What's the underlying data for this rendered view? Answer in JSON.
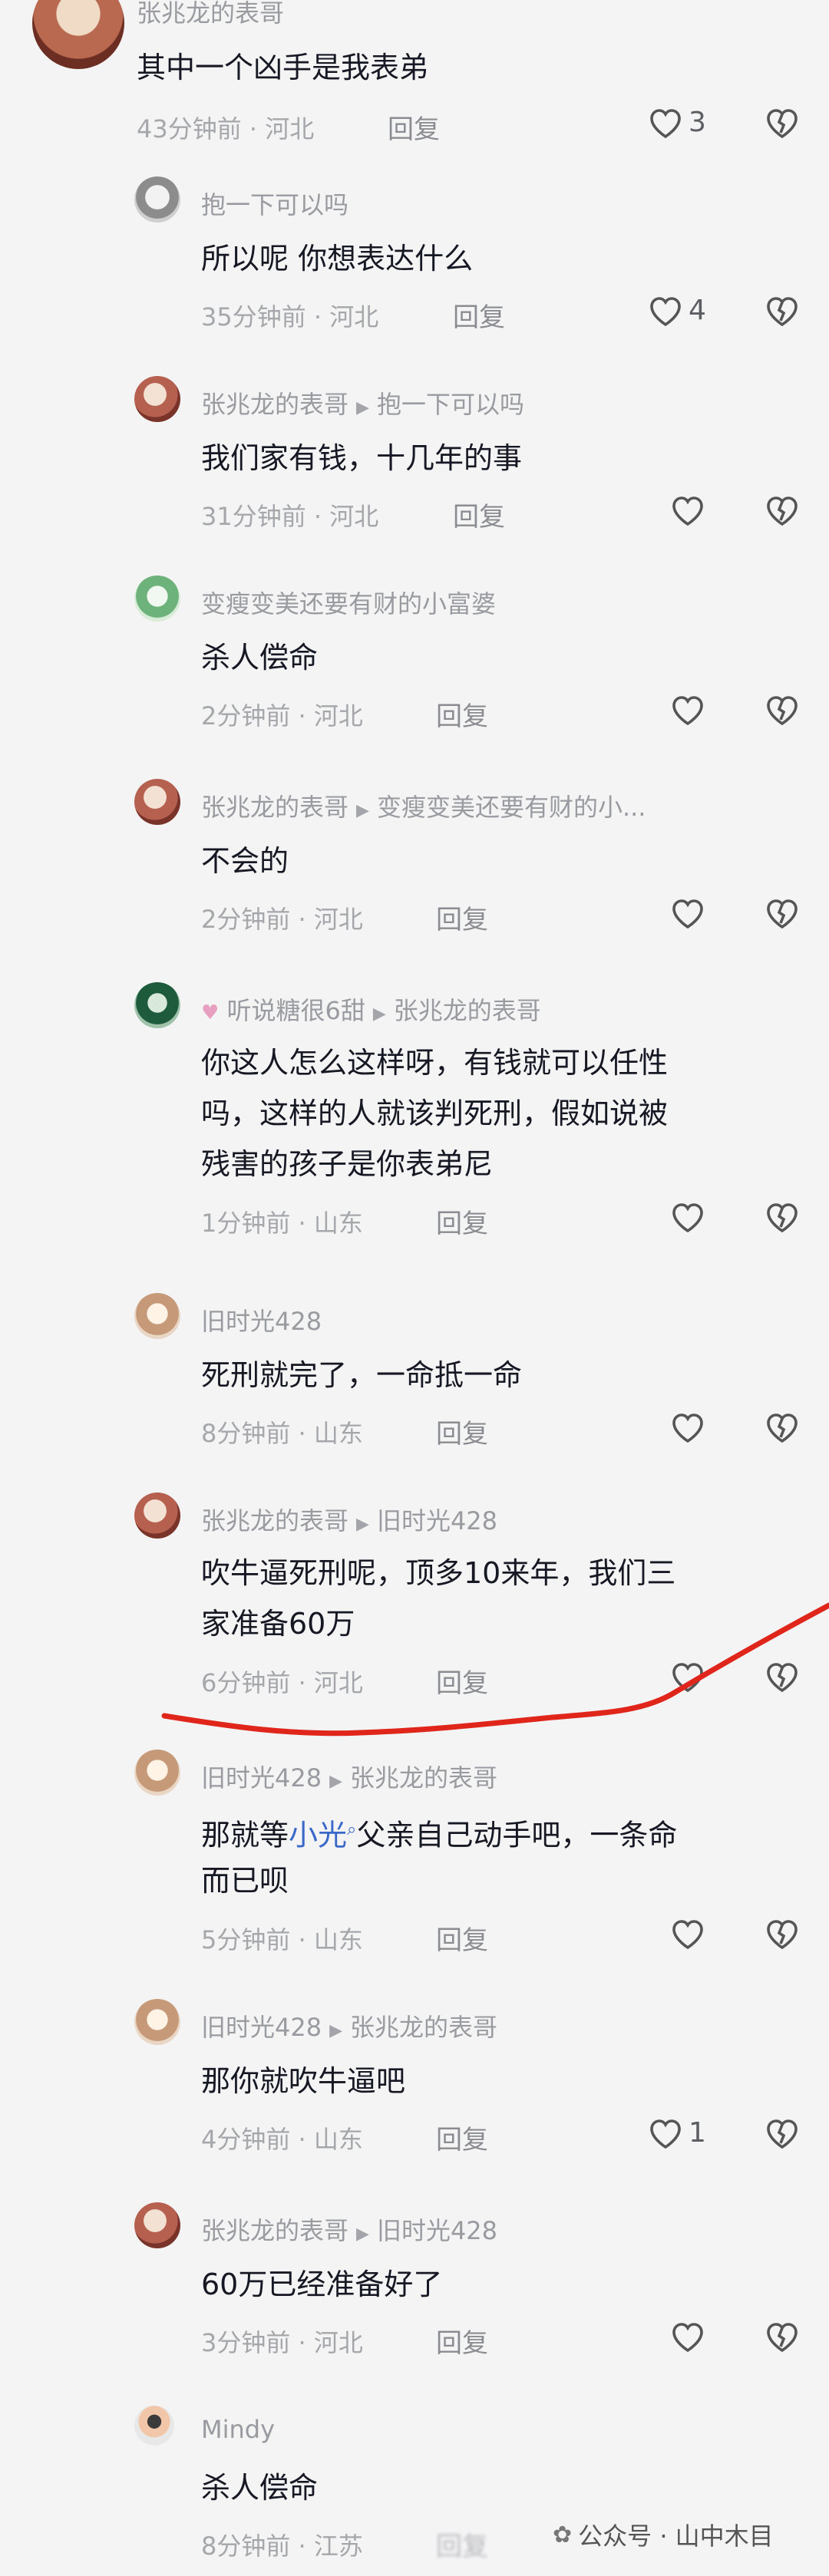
{
  "comments": [
    {
      "user": "张兆龙的表哥",
      "reply_to": "",
      "text": [
        "其中一个凶手是我表弟"
      ],
      "time": "43分钟前",
      "location": "河北",
      "reply": "回复",
      "likes": "3"
    },
    {
      "user": "抱一下可以吗",
      "reply_to": "",
      "text": [
        "所以呢 你想表达什么"
      ],
      "time": "35分钟前",
      "location": "河北",
      "reply": "回复",
      "likes": "4"
    },
    {
      "user": "张兆龙的表哥",
      "reply_to": "抱一下可以吗",
      "text": [
        "我们家有钱，十几年的事"
      ],
      "time": "31分钟前",
      "location": "河北",
      "reply": "回复",
      "likes": ""
    },
    {
      "user": "变瘦变美还要有财的小富婆",
      "reply_to": "",
      "text": [
        "杀人偿命"
      ],
      "time": "2分钟前",
      "location": "河北",
      "reply": "回复",
      "likes": ""
    },
    {
      "user": "张兆龙的表哥",
      "reply_to": "变瘦变美还要有财的小...",
      "text": [
        "不会的"
      ],
      "time": "2分钟前",
      "location": "河北",
      "reply": "回复",
      "likes": ""
    },
    {
      "user": "听说糖很6甜",
      "reply_to": "张兆龙的表哥",
      "text": [
        "你这人怎么这样呀，有钱就可以任性",
        "吗，这样的人就该判死刑，假如说被",
        "残害的孩子是你表弟尼"
      ],
      "time": "1分钟前",
      "location": "山东",
      "reply": "回复",
      "likes": ""
    },
    {
      "user": "旧时光428",
      "reply_to": "",
      "text": [
        "死刑就完了，一命抵一命"
      ],
      "time": "8分钟前",
      "location": "山东",
      "reply": "回复",
      "likes": ""
    },
    {
      "user": "张兆龙的表哥",
      "reply_to": "旧时光428",
      "text": [
        "吹牛逼死刑呢，顶多10来年，我们三",
        "家准备60万"
      ],
      "time": "6分钟前",
      "location": "河北",
      "reply": "回复",
      "likes": ""
    },
    {
      "user": "旧时光428",
      "reply_to": "张兆龙的表哥",
      "text_parts": [
        "那就等",
        "小光",
        "父亲自己动手吧，一条命",
        "而已呗"
      ],
      "time": "5分钟前",
      "location": "山东",
      "reply": "回复",
      "likes": ""
    },
    {
      "user": "旧时光428",
      "reply_to": "张兆龙的表哥",
      "text": [
        "那你就吹牛逼吧"
      ],
      "time": "4分钟前",
      "location": "山东",
      "reply": "回复",
      "likes": "1"
    },
    {
      "user": "张兆龙的表哥",
      "reply_to": "旧时光428",
      "text": [
        "60万已经准备好了"
      ],
      "time": "3分钟前",
      "location": "河北",
      "reply": "回复",
      "likes": ""
    },
    {
      "user": "Mindy",
      "reply_to": "",
      "text": [
        "杀人偿命"
      ],
      "time": "8分钟前",
      "location": "江苏",
      "reply": "回复",
      "likes": ""
    }
  ],
  "watermark": {
    "label": "公众号 · 山中木目"
  },
  "colors": {
    "annotation_line": "#e0261b",
    "link": "#3a69c9"
  }
}
